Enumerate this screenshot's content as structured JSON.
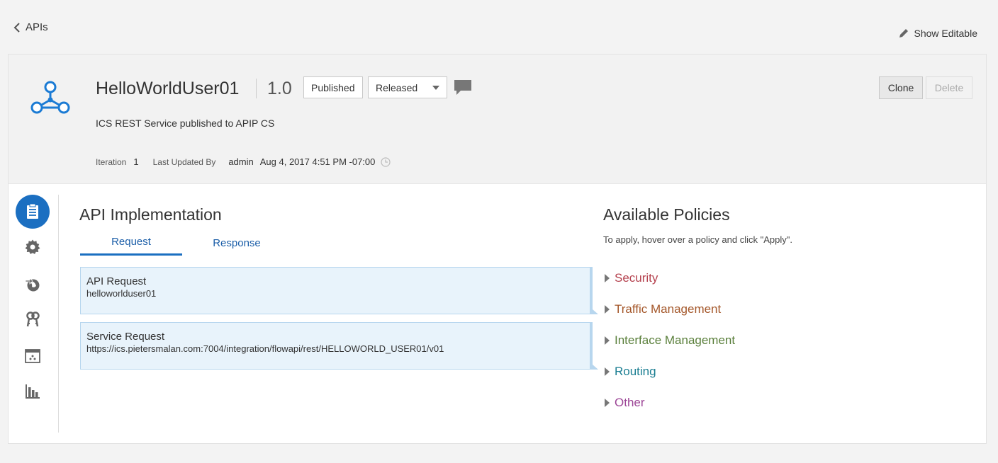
{
  "nav": {
    "back_label": "APIs",
    "show_editable_label": "Show Editable"
  },
  "api": {
    "name": "HelloWorldUser01",
    "version": "1.0",
    "status": "Published",
    "state": "Released",
    "description": "ICS REST Service published to APIP CS",
    "iteration_label": "Iteration",
    "iteration_value": "1",
    "updated_by_label": "Last Updated By",
    "updated_by_value": "admin",
    "updated_at": "Aug 4, 2017 4:51 PM -07:00"
  },
  "actions": {
    "clone_label": "Clone",
    "delete_label": "Delete"
  },
  "side_nav": [
    {
      "icon": "clipboard-icon",
      "active": true
    },
    {
      "icon": "gear-icon",
      "active": false
    },
    {
      "icon": "globe-deploy-icon",
      "active": false
    },
    {
      "icon": "keys-icon",
      "active": false
    },
    {
      "icon": "calendar-icon",
      "active": false
    },
    {
      "icon": "bar-chart-icon",
      "active": false
    }
  ],
  "implementation": {
    "title": "API Implementation",
    "tabs": [
      "Request",
      "Response"
    ],
    "active_tab": "Request",
    "flow": [
      {
        "title": "API Request",
        "subtitle": "helloworlduser01"
      },
      {
        "title": "Service Request",
        "subtitle": "https://ics.pietersmalan.com:7004/integration/flowapi/rest/HELLOWORLD_USER01/v01"
      }
    ]
  },
  "policies": {
    "title": "Available Policies",
    "hint": "To apply, hover over a policy and click \"Apply\".",
    "items": [
      {
        "label": "Security",
        "color": "#b5424f"
      },
      {
        "label": "Traffic Management",
        "color": "#a4572a"
      },
      {
        "label": "Interface Management",
        "color": "#5a7f3b"
      },
      {
        "label": "Routing",
        "color": "#1b7e92"
      },
      {
        "label": "Other",
        "color": "#9c4596"
      }
    ]
  },
  "colors": {
    "accent": "#1b6fc1",
    "flow_bg": "#e8f3fb"
  }
}
